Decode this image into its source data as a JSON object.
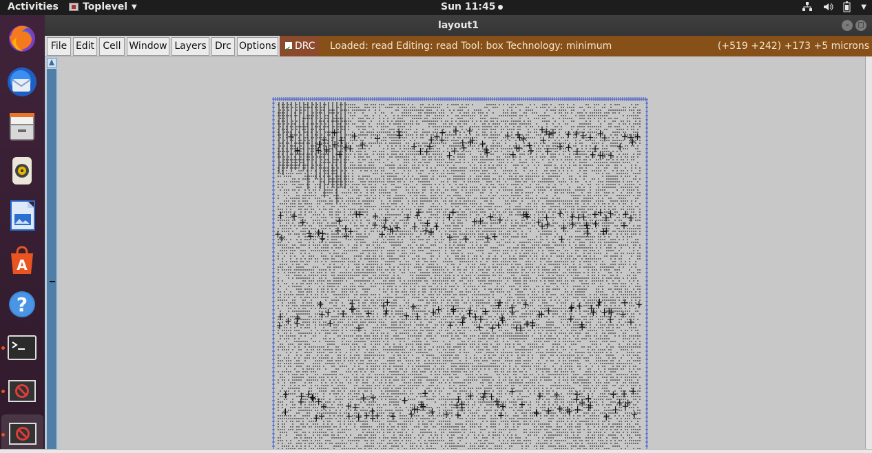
{
  "topbar": {
    "activities": "Activities",
    "app_name": "Toplevel",
    "clock": "Sun 11:45",
    "tray_icons": [
      "network-icon",
      "volume-icon",
      "battery-icon"
    ]
  },
  "dock": {
    "items": [
      {
        "name": "firefox-icon"
      },
      {
        "name": "thunderbird-icon"
      },
      {
        "name": "files-icon"
      },
      {
        "name": "rhythmbox-icon"
      },
      {
        "name": "libreoffice-writer-icon"
      },
      {
        "name": "software-center-icon"
      },
      {
        "name": "help-icon"
      },
      {
        "name": "terminal-icon"
      },
      {
        "name": "no-entry-icon"
      },
      {
        "name": "no-entry-icon"
      }
    ]
  },
  "window": {
    "title": "layout1"
  },
  "menubar": {
    "items": [
      "File",
      "Edit",
      "Cell",
      "Window",
      "Layers",
      "Drc",
      "Options"
    ],
    "drc_label": "DRC",
    "status_message": "Loaded: read Editing: read Tool: box  Technology: minimum",
    "coords": "(+519 +242) +173 +5 microns"
  },
  "colors": {
    "canvas_bg": "#c8c8c8",
    "status_bg": "#875018",
    "drc_bg": "#8b4a2c",
    "layout_boundary": "#3b57c9"
  }
}
